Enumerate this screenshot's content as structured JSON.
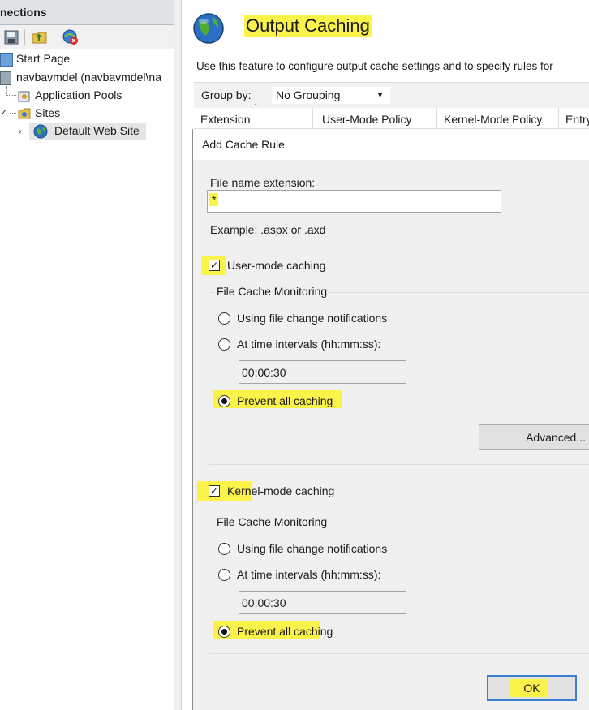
{
  "connections": {
    "title": "nections",
    "tree": [
      {
        "label": "Start Page"
      },
      {
        "label": "navbavmdel (navbavmdel\\na"
      },
      {
        "label": "Application Pools"
      },
      {
        "label": "Sites"
      },
      {
        "label": "Default Web Site"
      }
    ]
  },
  "feature": {
    "title": "Output Caching",
    "description": "Use this feature to configure output cache settings and to specify rules for",
    "group_by_label": "Group by:",
    "group_by_value": "No Grouping",
    "columns": [
      "Extension",
      "User-Mode Policy",
      "Kernel-Mode Policy",
      "Entry"
    ]
  },
  "dialog": {
    "title": "Add Cache Rule",
    "file_ext_label": "File name extension:",
    "file_ext_value": "*",
    "example": "Example: .aspx or .axd",
    "user_mode": {
      "label": "User-mode caching",
      "checked": true,
      "monitoring_label": "File Cache Monitoring",
      "opt_notifications": "Using file change notifications",
      "opt_intervals": "At time intervals (hh:mm:ss):",
      "interval_value": "00:00:30",
      "opt_prevent": "Prevent all caching",
      "selected": "prevent",
      "advanced_label": "Advanced..."
    },
    "kernel_mode": {
      "label": "Kernel-mode caching",
      "checked": true,
      "monitoring_label": "File Cache Monitoring",
      "opt_notifications": "Using file change notifications",
      "opt_intervals": "At time intervals (hh:mm:ss):",
      "interval_value": "00:00:30",
      "opt_prevent": "Prevent all caching",
      "selected": "prevent"
    },
    "ok_label": "OK"
  },
  "colors": {
    "highlight": "#fbf34a",
    "ok_border": "#3c7fd0"
  }
}
